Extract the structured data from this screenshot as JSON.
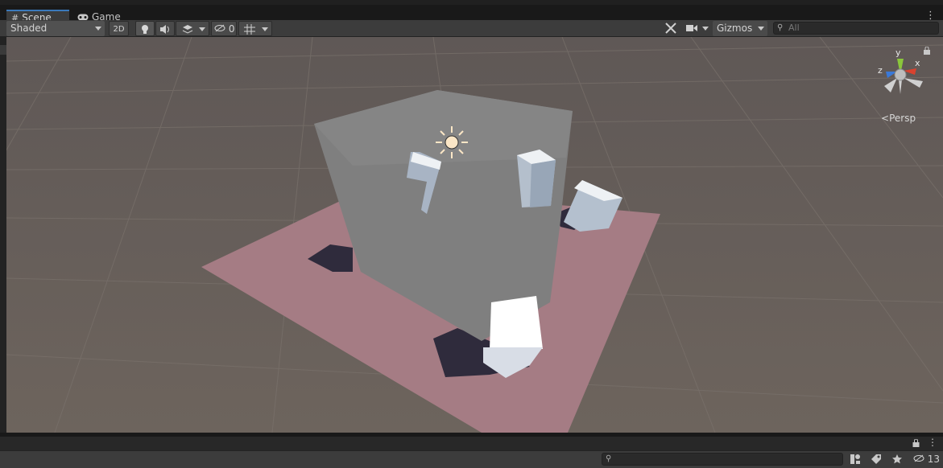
{
  "tabs": [
    {
      "label": "Scene",
      "icon": "grid-icon",
      "active": true
    },
    {
      "label": "Game",
      "icon": "gamepad-icon",
      "active": false
    }
  ],
  "toolbar": {
    "draw_mode": "Shaded",
    "twod_label": "2D",
    "hidden_count": "0",
    "gizmos_label": "Gizmos",
    "search_placeholder": "All"
  },
  "orientation": {
    "y_label": "y",
    "x_label": "x",
    "z_label": "z",
    "projection_label": "Persp"
  },
  "bottom": {
    "hidden_objects_count": "13"
  },
  "colors": {
    "accent": "#3a79bb",
    "toolbar": "#3c3c3c",
    "ground": "#6b625c",
    "plane": "#a67c84",
    "cube": "#808080",
    "axis_x": "#d9422f",
    "axis_y": "#8ac73b",
    "axis_z": "#3a79d8"
  }
}
